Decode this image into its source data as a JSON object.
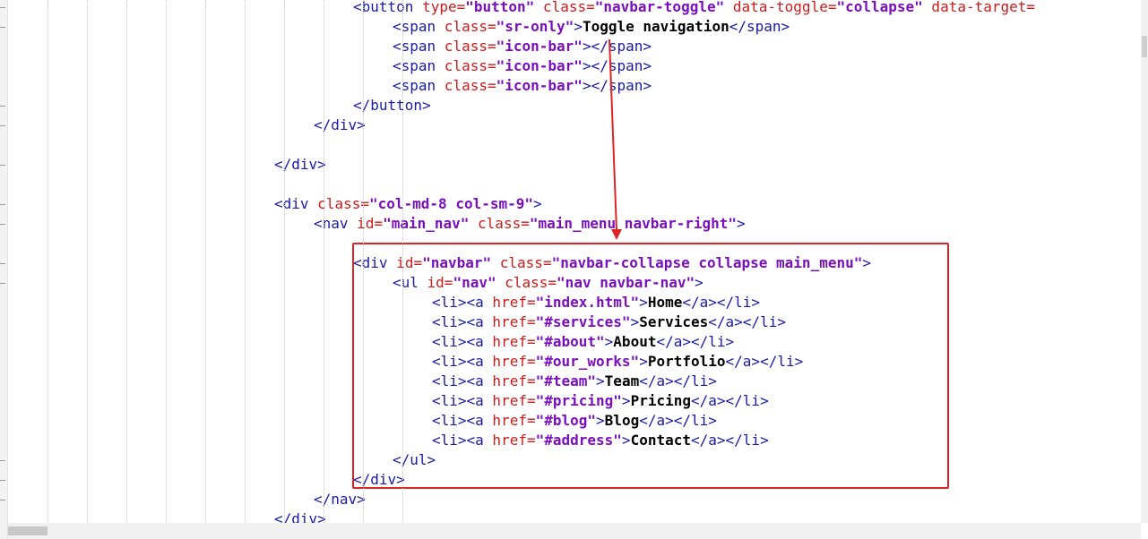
{
  "editor": {
    "lines": [
      [
        [
          "<",
          "pl"
        ],
        [
          "button",
          "tg"
        ],
        [
          " type=",
          "at"
        ],
        [
          "\"button\"",
          "vl"
        ],
        [
          " class=",
          "at"
        ],
        [
          "\"navbar-toggle\"",
          "vl"
        ],
        [
          " data-toggle=",
          "at"
        ],
        [
          "\"collapse\"",
          "vl"
        ],
        [
          " data-target=",
          "at"
        ]
      ],
      [
        [
          "<",
          "pl"
        ],
        [
          "span",
          "tg"
        ],
        [
          " class=",
          "at"
        ],
        [
          "\"sr-only\"",
          "vl"
        ],
        [
          ">",
          "pl"
        ],
        [
          "Toggle navigation",
          "tx"
        ],
        [
          "</span>",
          "pl"
        ]
      ],
      [
        [
          "<",
          "pl"
        ],
        [
          "span",
          "tg"
        ],
        [
          " class=",
          "at"
        ],
        [
          "\"icon-bar\"",
          "vl"
        ],
        [
          "></span>",
          "pl"
        ]
      ],
      [
        [
          "<",
          "pl"
        ],
        [
          "span",
          "tg"
        ],
        [
          " class=",
          "at"
        ],
        [
          "\"icon-bar\"",
          "vl"
        ],
        [
          "></span>",
          "pl"
        ]
      ],
      [
        [
          "<",
          "pl"
        ],
        [
          "span",
          "tg"
        ],
        [
          " class=",
          "at"
        ],
        [
          "\"icon-bar\"",
          "vl"
        ],
        [
          "></span>",
          "pl"
        ]
      ],
      [
        [
          "</button>",
          "pl"
        ]
      ],
      [
        [
          "</div>",
          "pl"
        ]
      ],
      [],
      [
        [
          "</div>",
          "pl"
        ]
      ],
      [],
      [
        [
          "<",
          "pl"
        ],
        [
          "div",
          "tg"
        ],
        [
          " class=",
          "at"
        ],
        [
          "\"col-md-8 col-sm-9\"",
          "vl"
        ],
        [
          ">",
          "pl"
        ]
      ],
      [
        [
          "<",
          "pl"
        ],
        [
          "nav",
          "tg"
        ],
        [
          " id=",
          "at"
        ],
        [
          "\"main_nav\"",
          "vl"
        ],
        [
          " class=",
          "at"
        ],
        [
          "\"main_menu navbar-right\"",
          "vl"
        ],
        [
          ">",
          "pl"
        ]
      ],
      [],
      [
        [
          "<",
          "pl"
        ],
        [
          "div",
          "tg"
        ],
        [
          " id=",
          "at"
        ],
        [
          "\"navbar\"",
          "vl"
        ],
        [
          " class=",
          "at"
        ],
        [
          "\"navbar-collapse collapse main_menu\"",
          "vl"
        ],
        [
          ">",
          "pl"
        ]
      ],
      [
        [
          "<",
          "pl"
        ],
        [
          "ul",
          "tg"
        ],
        [
          " id=",
          "at"
        ],
        [
          "\"nav\"",
          "vl"
        ],
        [
          " class=",
          "at"
        ],
        [
          "\"nav navbar-nav\"",
          "vl"
        ],
        [
          ">",
          "pl"
        ]
      ],
      [
        [
          "<li><a",
          "pl"
        ],
        [
          " href=",
          "at"
        ],
        [
          "\"index.html\"",
          "vl"
        ],
        [
          ">",
          "pl"
        ],
        [
          "Home",
          "tx"
        ],
        [
          "</a></li>",
          "pl"
        ]
      ],
      [
        [
          "<li><a",
          "pl"
        ],
        [
          " href=",
          "at"
        ],
        [
          "\"#services\"",
          "vl"
        ],
        [
          ">",
          "pl"
        ],
        [
          "Services",
          "tx"
        ],
        [
          "</a></li>",
          "pl"
        ]
      ],
      [
        [
          "<li><a",
          "pl"
        ],
        [
          " href=",
          "at"
        ],
        [
          "\"#about\"",
          "vl"
        ],
        [
          ">",
          "pl"
        ],
        [
          "About",
          "tx"
        ],
        [
          "</a></li>",
          "pl"
        ]
      ],
      [
        [
          "<li><a",
          "pl"
        ],
        [
          " href=",
          "at"
        ],
        [
          "\"#our_works\"",
          "vl"
        ],
        [
          ">",
          "pl"
        ],
        [
          "Portfolio",
          "tx"
        ],
        [
          "</a></li>",
          "pl"
        ]
      ],
      [
        [
          "<li><a",
          "pl"
        ],
        [
          " href=",
          "at"
        ],
        [
          "\"#team\"",
          "vl"
        ],
        [
          ">",
          "pl"
        ],
        [
          "Team",
          "tx"
        ],
        [
          "</a></li>",
          "pl"
        ]
      ],
      [
        [
          "<li><a",
          "pl"
        ],
        [
          " href=",
          "at"
        ],
        [
          "\"#pricing\"",
          "vl"
        ],
        [
          ">",
          "pl"
        ],
        [
          "Pricing",
          "tx"
        ],
        [
          "</a></li>",
          "pl"
        ]
      ],
      [
        [
          "<li><a",
          "pl"
        ],
        [
          " href=",
          "at"
        ],
        [
          "\"#blog\"",
          "vl"
        ],
        [
          ">",
          "pl"
        ],
        [
          "Blog",
          "tx"
        ],
        [
          "</a></li>",
          "pl"
        ]
      ],
      [
        [
          "<li><a",
          "pl"
        ],
        [
          " href=",
          "at"
        ],
        [
          "\"#address\"",
          "vl"
        ],
        [
          ">",
          "pl"
        ],
        [
          "Contact",
          "tx"
        ],
        [
          "</a></li>",
          "pl"
        ]
      ],
      [
        [
          "</ul>",
          "pl"
        ]
      ],
      [
        [
          "</div>",
          "pl"
        ]
      ],
      [
        [
          "</nav>",
          "pl"
        ]
      ],
      [
        [
          "</div>",
          "pl"
        ]
      ]
    ]
  },
  "annotation": {
    "color": "#e02424",
    "arrow_from": "Toggle navigation",
    "highlighted_block": "<div id=\"navbar\"> ... </div>"
  },
  "colors": {
    "tag": "#1a1aa6",
    "attribute": "#cc1b1b",
    "value": "#7a0fbd",
    "text": "#000000"
  }
}
